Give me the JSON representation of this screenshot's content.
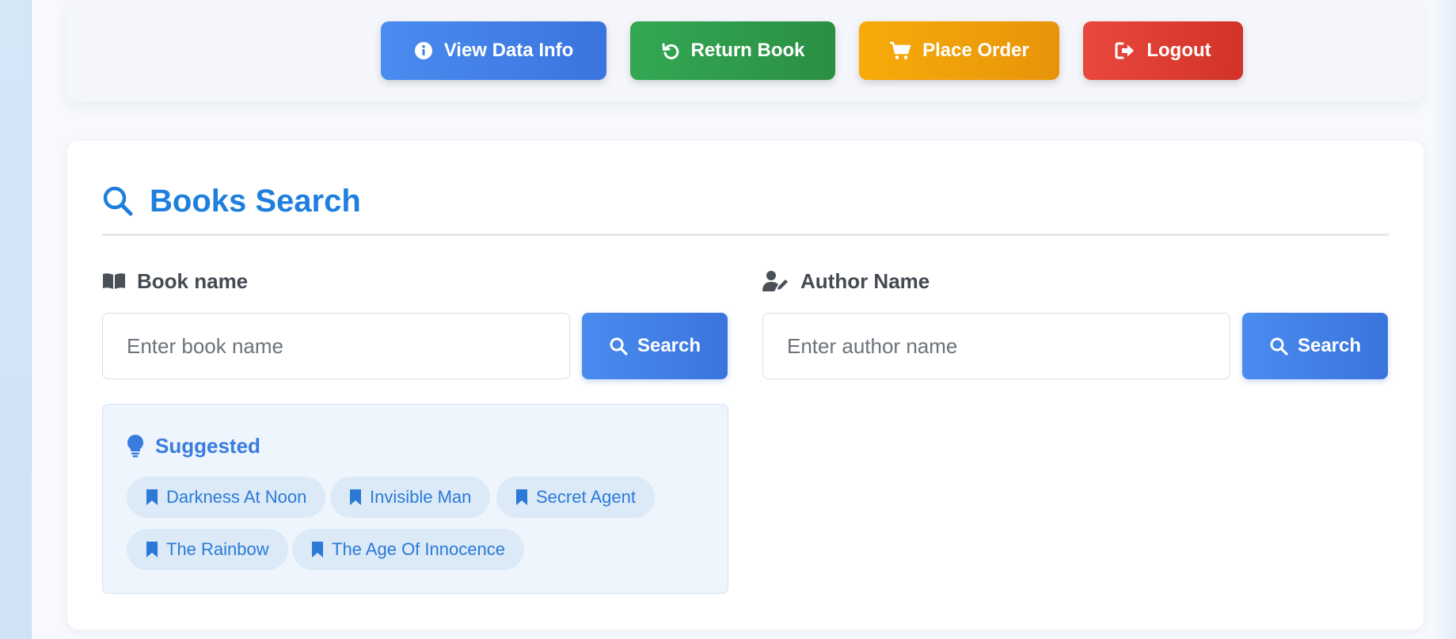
{
  "colors": {
    "primary": "#3a7be0",
    "success": "#2e9e4c",
    "warning": "#f0a00a",
    "danger": "#de3e33",
    "title": "#1e7fde"
  },
  "actions": {
    "view_data_info": {
      "label": "View Data Info",
      "icon": "info-circle-icon"
    },
    "return_book": {
      "label": "Return Book",
      "icon": "undo-icon"
    },
    "place_order": {
      "label": "Place Order",
      "icon": "cart-icon"
    },
    "logout": {
      "label": "Logout",
      "icon": "sign-out-icon"
    }
  },
  "search": {
    "title": "Books Search",
    "title_icon": "search-icon",
    "book": {
      "label": "Book name",
      "icon": "open-book-icon",
      "placeholder": "Enter book name",
      "value": "",
      "button_label": "Search"
    },
    "author": {
      "label": "Author Name",
      "icon": "user-edit-icon",
      "placeholder": "Enter author name",
      "value": "",
      "button_label": "Search"
    },
    "suggested": {
      "title": "Suggested",
      "icon": "lightbulb-icon",
      "items": [
        {
          "label": "Darkness At Noon",
          "icon": "bookmark-icon"
        },
        {
          "label": "Invisible Man",
          "icon": "bookmark-icon"
        },
        {
          "label": "Secret Agent",
          "icon": "bookmark-icon"
        },
        {
          "label": "The Rainbow",
          "icon": "bookmark-icon"
        },
        {
          "label": "The Age Of Innocence",
          "icon": "bookmark-icon"
        }
      ]
    }
  }
}
